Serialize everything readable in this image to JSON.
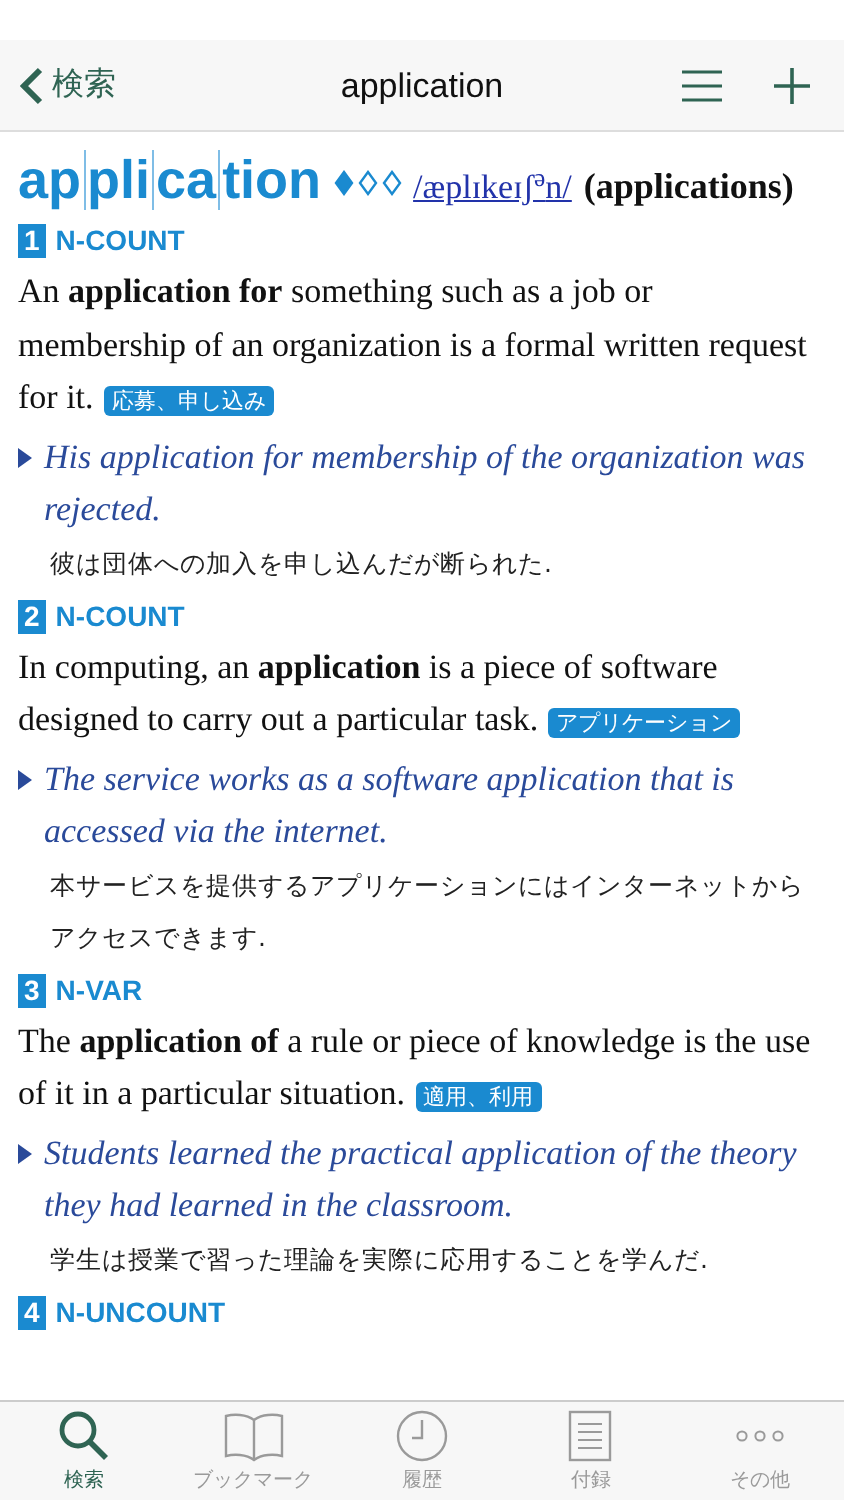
{
  "nav": {
    "back": "検索",
    "title": "application"
  },
  "entry": {
    "syllables": [
      "ap",
      "pli",
      "ca",
      "tion"
    ],
    "stars": 1,
    "pronunciation": "/æplɪkeɪʃ$^{ə}$n/",
    "plural": "(applications)"
  },
  "senses": [
    {
      "number": "1",
      "grammar": "N-COUNT",
      "definition": "An **application for** something such as a job or membership of an organization is a formal written request for it.",
      "tag": "応募、申し込み",
      "example": "His application for membership of the organization was rejected.",
      "translation": "彼は団体への加入を申し込んだが断られた."
    },
    {
      "number": "2",
      "grammar": "N-COUNT",
      "definition": "In computing, an **application** is a piece of software designed to carry out a particular task.",
      "tag": "アプリケーション",
      "example": "The service works as a software application that is accessed via the internet.",
      "translation": "本サービスを提供するアプリケーションにはインターネットからアクセスできます."
    },
    {
      "number": "3",
      "grammar": "N-VAR",
      "definition": "The **application of** a rule or piece of knowledge is the use of it in a particular situation.",
      "tag": "適用、利用",
      "example": "Students learned the practical application of the theory they had learned in the classroom.",
      "translation": "学生は授業で習った理論を実際に応用することを学んだ."
    },
    {
      "number": "4",
      "grammar": "N-UNCOUNT"
    }
  ],
  "tabs": [
    {
      "kind": "search",
      "label": "検索",
      "selected": true
    },
    {
      "kind": "bookmark",
      "label": "ブックマーク",
      "selected": false
    },
    {
      "kind": "history",
      "label": "履歴",
      "selected": false
    },
    {
      "kind": "appendix",
      "label": "付録",
      "selected": false
    },
    {
      "kind": "more",
      "label": "その他",
      "selected": false
    }
  ]
}
